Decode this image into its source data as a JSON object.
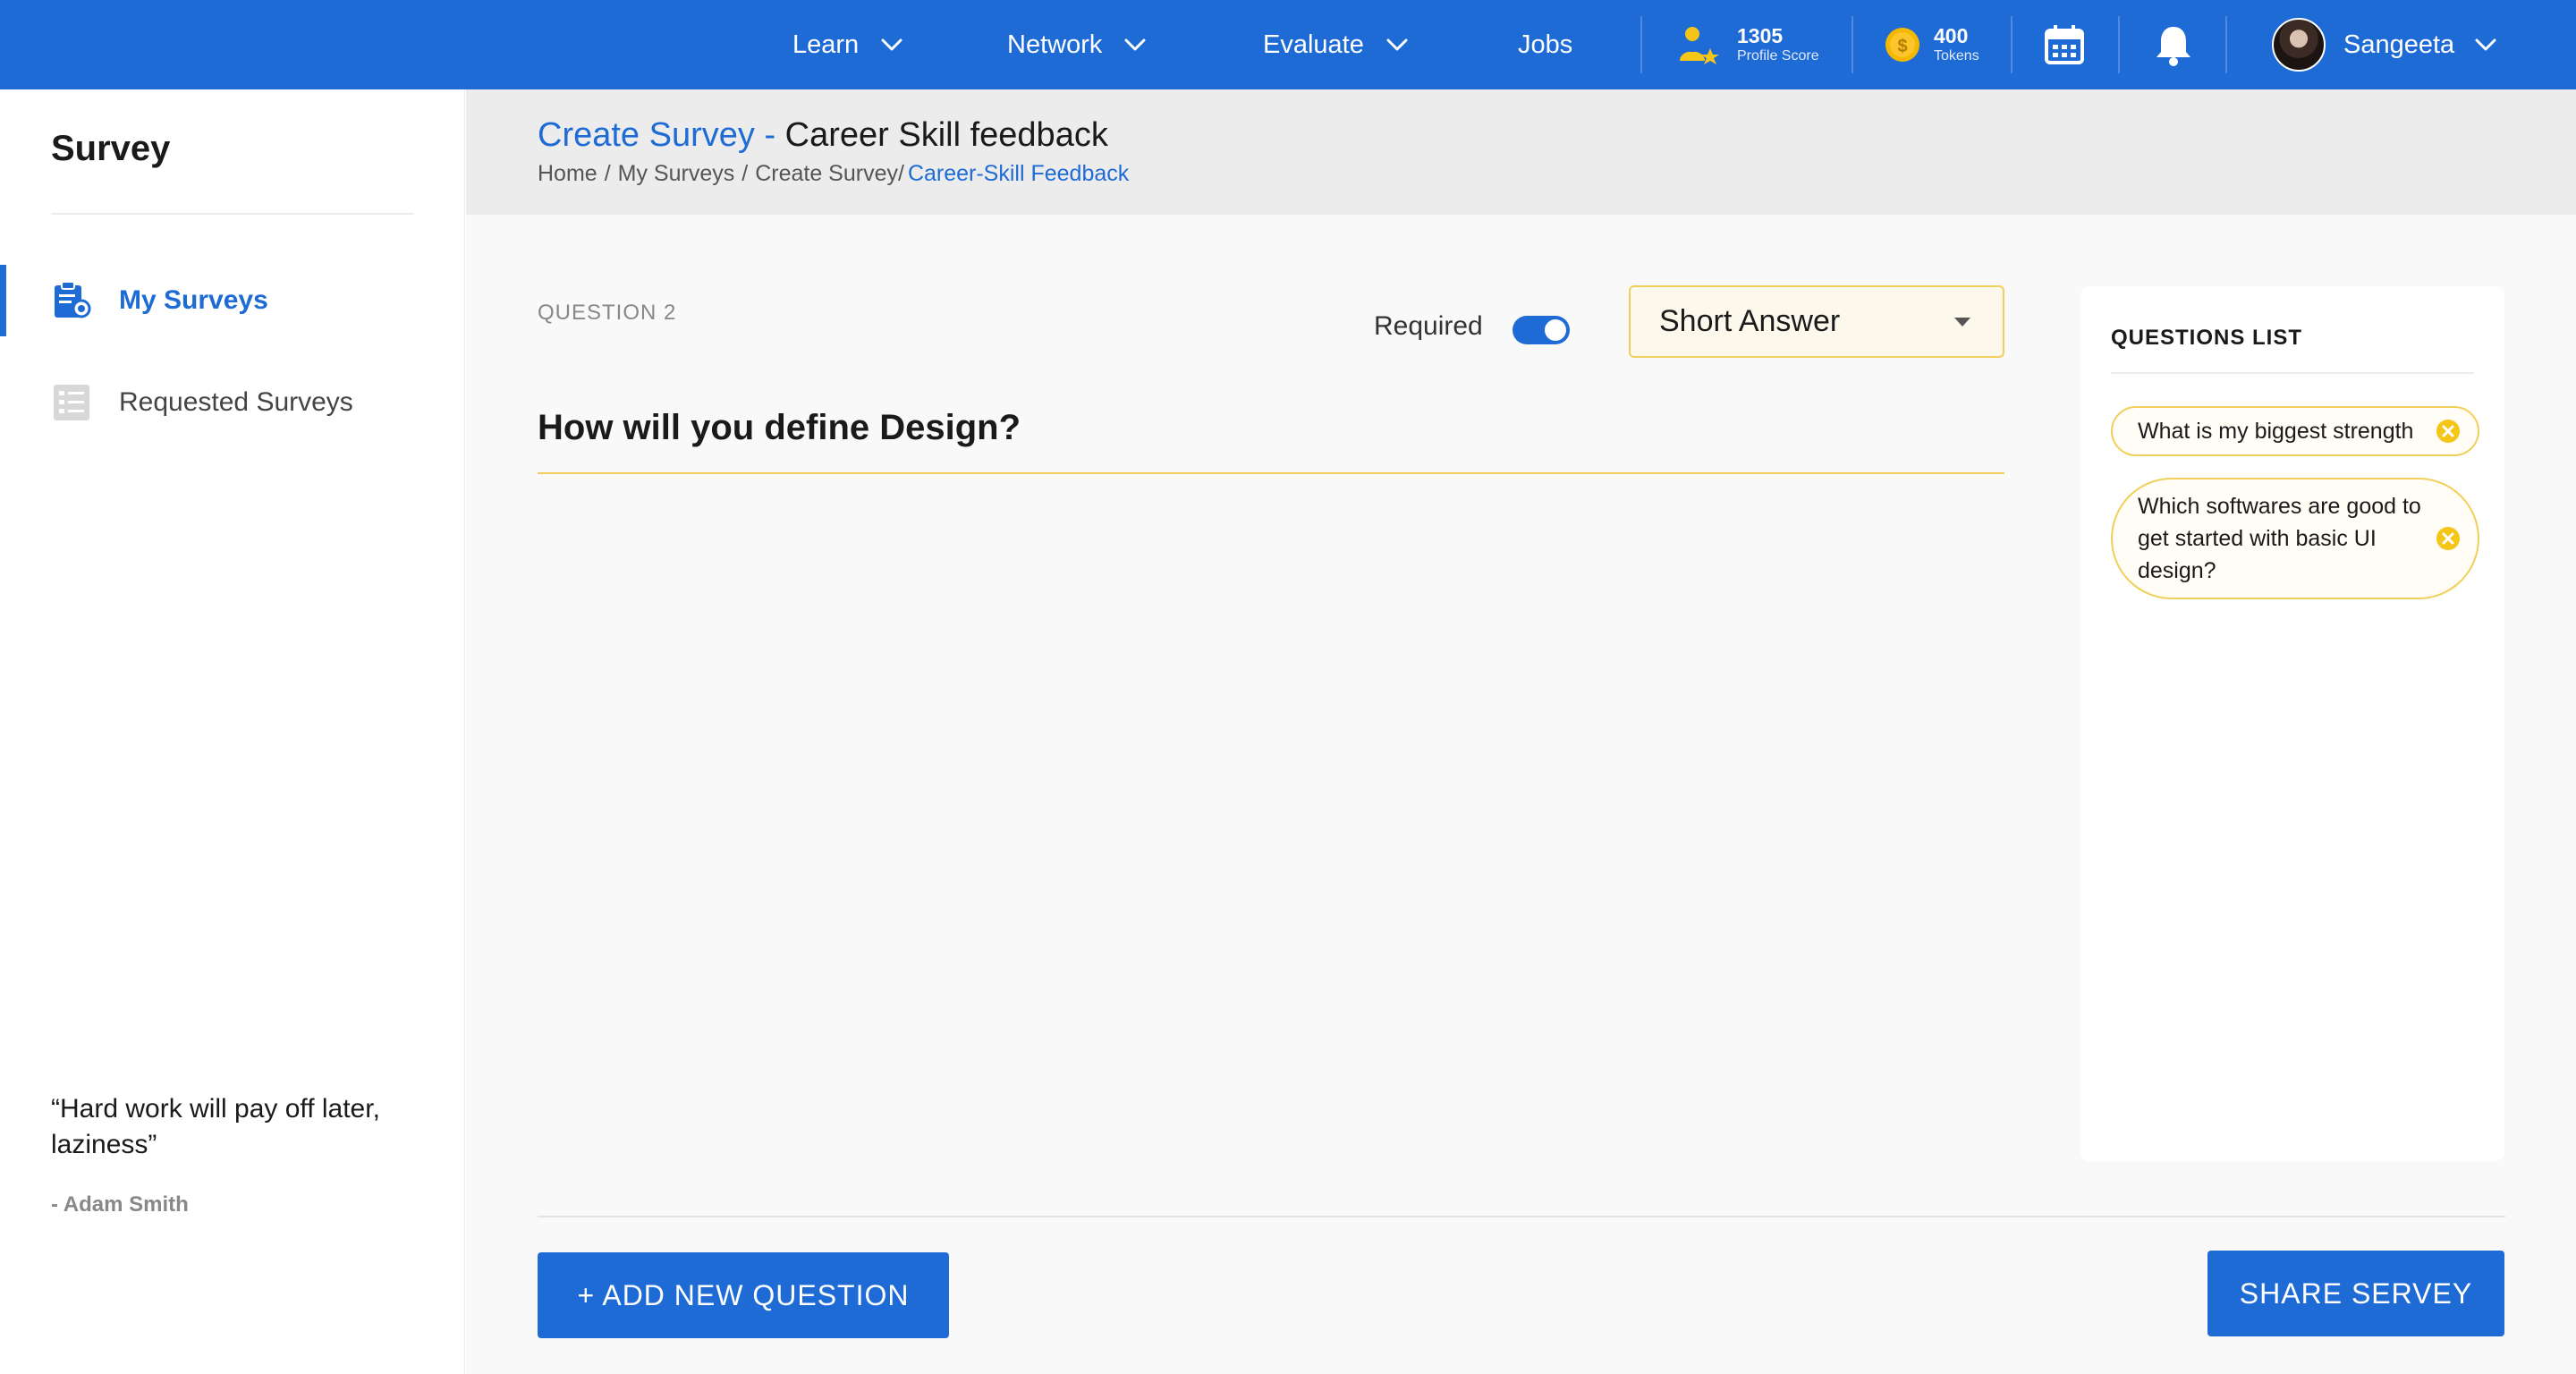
{
  "nav": {
    "items": [
      {
        "label": "Learn"
      },
      {
        "label": "Network"
      },
      {
        "label": "Evaluate"
      },
      {
        "label": "Jobs"
      }
    ],
    "profile_score": {
      "value": "1305",
      "label": "Profile Score",
      "icon": "profile-score-icon"
    },
    "tokens": {
      "value": "400",
      "label": "Tokens",
      "icon": "token-coin-icon"
    },
    "user": {
      "name": "Sangeeta"
    }
  },
  "sidebar": {
    "title": "Survey",
    "items": [
      {
        "label": "My Surveys",
        "icon": "survey-clipboard-icon",
        "active": true
      },
      {
        "label": "Requested Surveys",
        "icon": "requested-list-icon",
        "active": false
      }
    ],
    "quote": {
      "text": "“Hard work will pay off later, laziness”",
      "author": "- Adam Smith"
    }
  },
  "header": {
    "title_accent": "Create Survey - ",
    "title_rest": "Career Skill feedback",
    "breadcrumb": [
      "Home",
      "My Surveys",
      "Create Survey/"
    ],
    "breadcrumb_current": "Career-Skill Feedback"
  },
  "editor": {
    "question_number": "QUESTION 2",
    "required_label": "Required",
    "required_on": true,
    "answer_type": "Short Answer",
    "question_text": "How will you define Design?"
  },
  "questions_list": {
    "title": "QUESTIONS LIST",
    "items": [
      "What is my biggest strength",
      "Which softwares are good to get started with basic UI design?"
    ]
  },
  "actions": {
    "add_label": "+ ADD NEW QUESTION",
    "share_label": "SHARE SERVEY"
  },
  "colors": {
    "brand": "#1e6bd6",
    "accent_yellow": "#f0cf5a",
    "coin": "#f5b800"
  }
}
